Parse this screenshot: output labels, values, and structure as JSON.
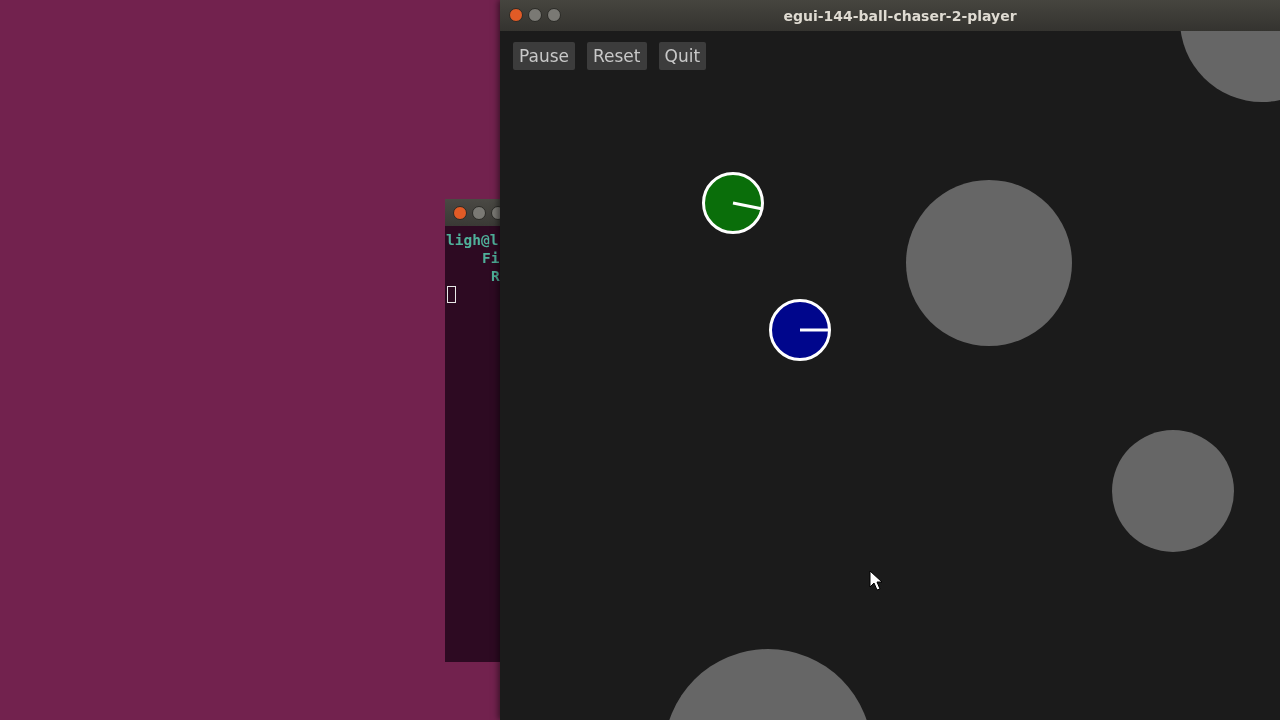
{
  "terminal": {
    "lines": [
      "ligh@l",
      "Fi",
      "R"
    ]
  },
  "window": {
    "title": "egui-144-ball-chaser-2-player"
  },
  "buttons": [
    "Pause",
    "Reset",
    "Quit"
  ],
  "players": [
    {
      "color": "#0a6e0a"
    },
    {
      "color": "#00068c"
    }
  ]
}
